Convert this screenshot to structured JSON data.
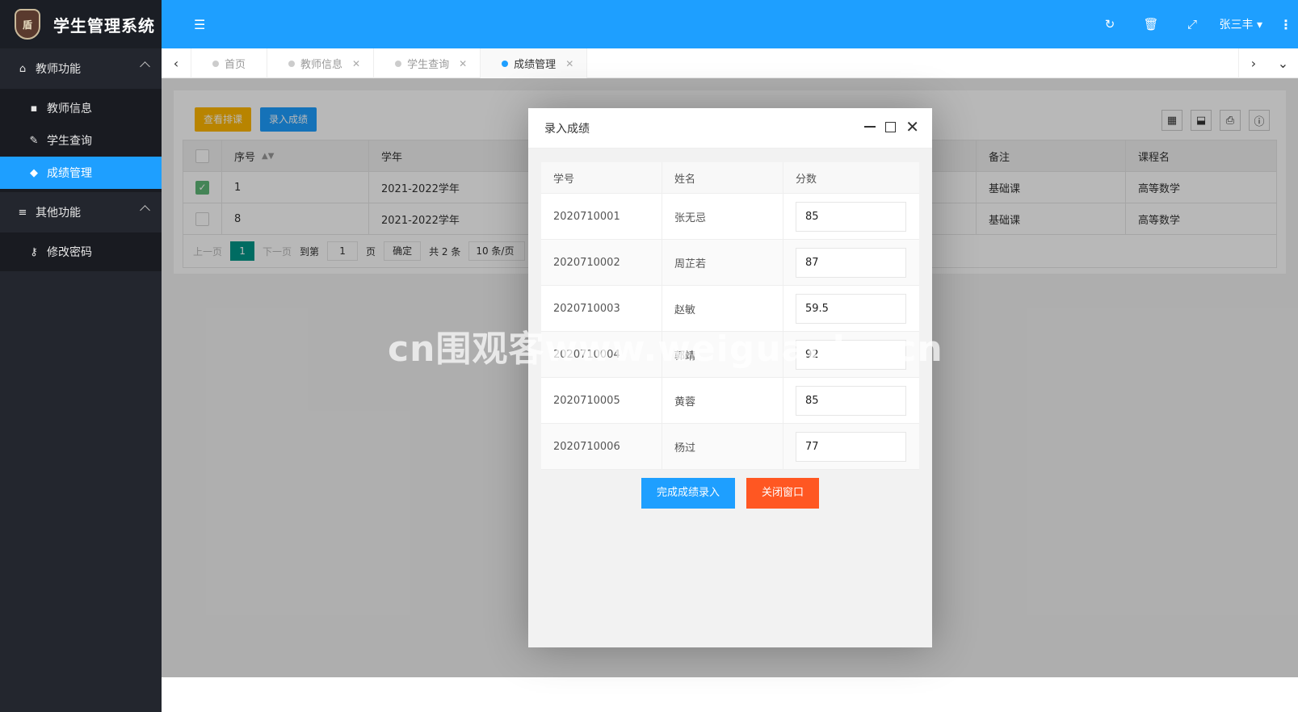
{
  "app": {
    "title": "学生管理系统",
    "logo_text": "盾"
  },
  "sidebar": {
    "groups": [
      {
        "label": "教师功能",
        "icon": "home-icon",
        "items": [
          {
            "label": "教师信息",
            "icon": "briefcase-icon"
          },
          {
            "label": "学生查询",
            "icon": "pencil-icon"
          },
          {
            "label": "成绩管理",
            "icon": "graduation-cap-icon",
            "active": true
          }
        ]
      },
      {
        "label": "其他功能",
        "icon": "list-icon",
        "items": [
          {
            "label": "修改密码",
            "icon": "key-icon"
          }
        ]
      }
    ]
  },
  "header": {
    "user": "张三丰"
  },
  "tabs": [
    {
      "label": "首页"
    },
    {
      "label": "教师信息"
    },
    {
      "label": "学生查询"
    },
    {
      "label": "成绩管理",
      "active": true
    }
  ],
  "toolbar": {
    "schedule_label": "查看排课",
    "enter_label": "录入成绩"
  },
  "grid": {
    "headers": {
      "no": "序号",
      "year": "学年",
      "remark": "备注",
      "course": "课程名"
    },
    "rows": [
      {
        "checked": true,
        "no": "1",
        "year": "2021-2022学年",
        "remark": "基础课",
        "course": "高等数学"
      },
      {
        "checked": false,
        "no": "8",
        "year": "2021-2022学年",
        "remark": "基础课",
        "course": "高等数学"
      }
    ]
  },
  "pager": {
    "prev": "上一页",
    "current": "1",
    "next": "下一页",
    "goto": "到第",
    "goto_value": "1",
    "page_unit": "页",
    "confirm": "确定",
    "total": "共 2 条",
    "limit": "10 条/页"
  },
  "modal": {
    "title": "录入成绩",
    "headers": {
      "id": "学号",
      "name": "姓名",
      "score": "分数"
    },
    "rows": [
      {
        "id": "2020710001",
        "name": "张无忌",
        "score": "85"
      },
      {
        "id": "2020710002",
        "name": "周芷若",
        "score": "87"
      },
      {
        "id": "2020710003",
        "name": "赵敏",
        "score": "59.5"
      },
      {
        "id": "2020710004",
        "name": "郭靖",
        "score": "92"
      },
      {
        "id": "2020710005",
        "name": "黄蓉",
        "score": "85"
      },
      {
        "id": "2020710006",
        "name": "杨过",
        "score": "77"
      }
    ],
    "submit_label": "完成成绩录入",
    "close_label": "关闭窗口"
  },
  "watermark": "cn围观客www.weiguanke.cn",
  "colors": {
    "primary": "#1e9fff",
    "sidebar": "#23262e",
    "warn": "#ffb800",
    "danger": "#ff5722",
    "pager_active": "#009688"
  }
}
